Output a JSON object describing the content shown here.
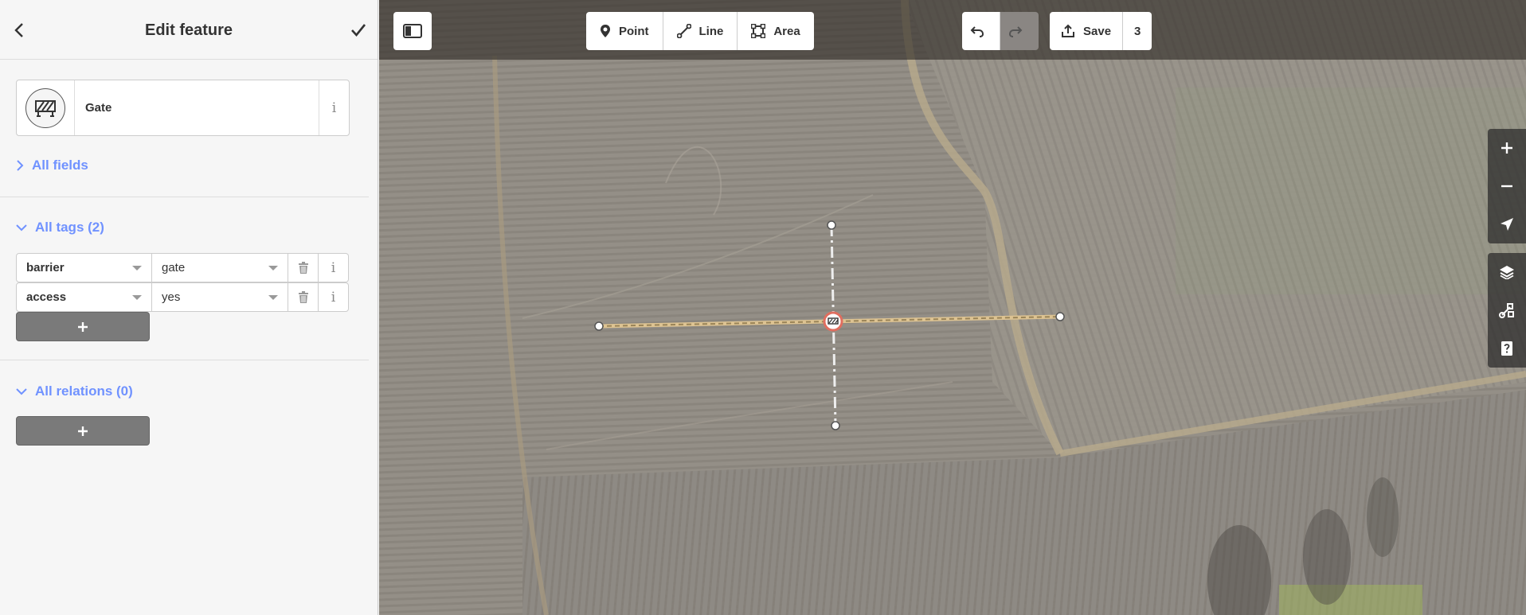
{
  "sidebar": {
    "title": "Edit feature",
    "preset": {
      "name": "Gate",
      "icon": "gate-icon",
      "info": "i"
    },
    "all_fields_label": "All fields",
    "all_tags_label": "All tags (2)",
    "tags": [
      {
        "key": "barrier",
        "value": "gate"
      },
      {
        "key": "access",
        "value": "yes"
      }
    ],
    "all_relations_label": "All relations (0)",
    "add_label": "+"
  },
  "toolbar": {
    "modes": [
      {
        "label": "Point",
        "icon": "point-icon"
      },
      {
        "label": "Line",
        "icon": "line-icon"
      },
      {
        "label": "Area",
        "icon": "area-icon"
      }
    ],
    "save_label": "Save",
    "save_count": "3"
  },
  "map_controls": [
    "zoom-in-icon",
    "zoom-out-icon",
    "geolocate-icon",
    "layers-icon",
    "map-data-icon",
    "help-icon"
  ],
  "colors": {
    "accent": "#7092ff",
    "line_tan": "#ddc392",
    "selected_red": "#e06e5f"
  }
}
